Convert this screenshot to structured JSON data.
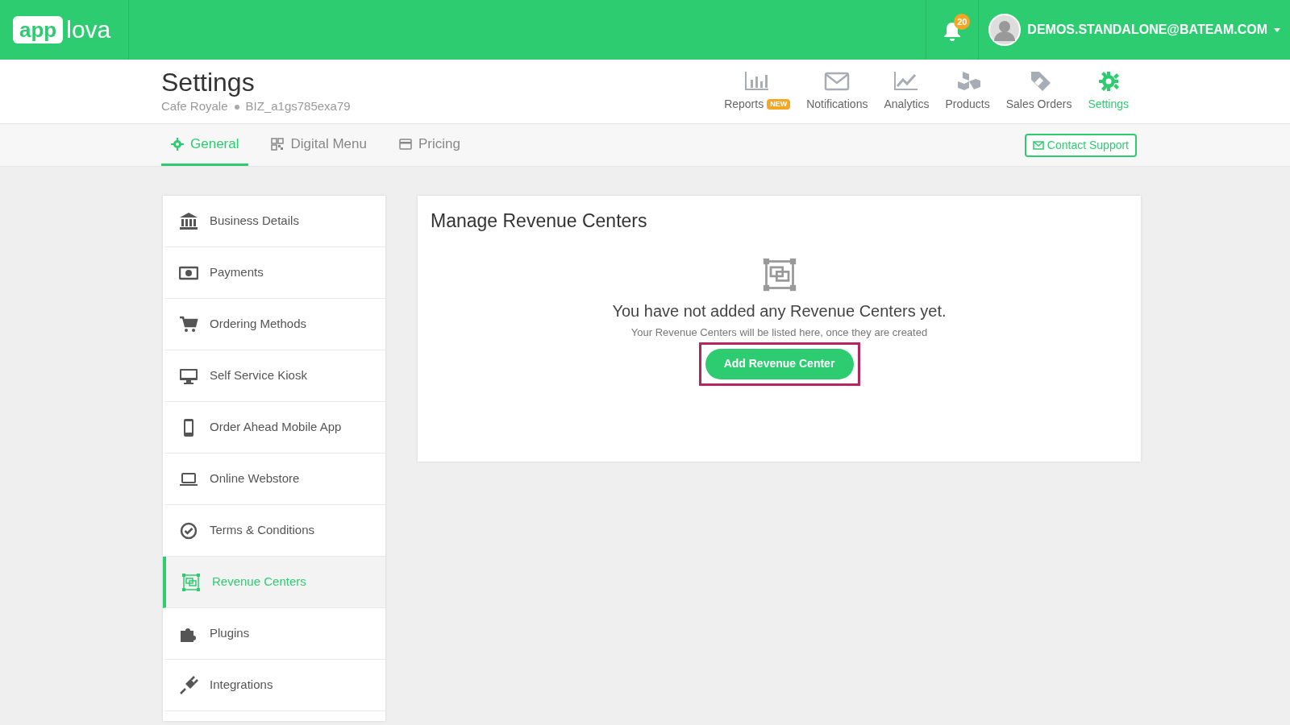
{
  "header": {
    "logo": {
      "left": "app",
      "right": "lova"
    },
    "notifications_count": "20",
    "user_email": "DEMOS.STANDALONE@BATEAM.COM"
  },
  "page": {
    "title": "Settings",
    "business_name": "Cafe Royale",
    "business_id": "BIZ_a1gs785exa79"
  },
  "nav": [
    {
      "label": "Reports",
      "badge": "NEW",
      "selected": false
    },
    {
      "label": "Notifications",
      "selected": false
    },
    {
      "label": "Analytics",
      "selected": false
    },
    {
      "label": "Products",
      "selected": false
    },
    {
      "label": "Sales Orders",
      "selected": false
    },
    {
      "label": "Settings",
      "selected": true
    }
  ],
  "tabs": [
    {
      "label": "General",
      "selected": true
    },
    {
      "label": "Digital Menu",
      "selected": false
    },
    {
      "label": "Pricing",
      "selected": false
    }
  ],
  "contact_button": "Contact Support",
  "sidebar": {
    "items": [
      {
        "label": "Business Details",
        "selected": false
      },
      {
        "label": "Payments",
        "selected": false
      },
      {
        "label": "Ordering Methods",
        "selected": false
      },
      {
        "label": "Self Service Kiosk",
        "selected": false
      },
      {
        "label": "Order Ahead Mobile App",
        "selected": false
      },
      {
        "label": "Online Webstore",
        "selected": false
      },
      {
        "label": "Terms & Conditions",
        "selected": false
      },
      {
        "label": "Revenue Centers",
        "selected": true
      },
      {
        "label": "Plugins",
        "selected": false
      },
      {
        "label": "Integrations",
        "selected": false
      }
    ]
  },
  "panel": {
    "title": "Manage Revenue Centers",
    "empty_title": "You have not added any Revenue Centers yet.",
    "empty_subtitle": "Your Revenue Centers will be listed here, once they are created",
    "button": {
      "label": "Add Revenue Center",
      "highlighted": true
    }
  }
}
